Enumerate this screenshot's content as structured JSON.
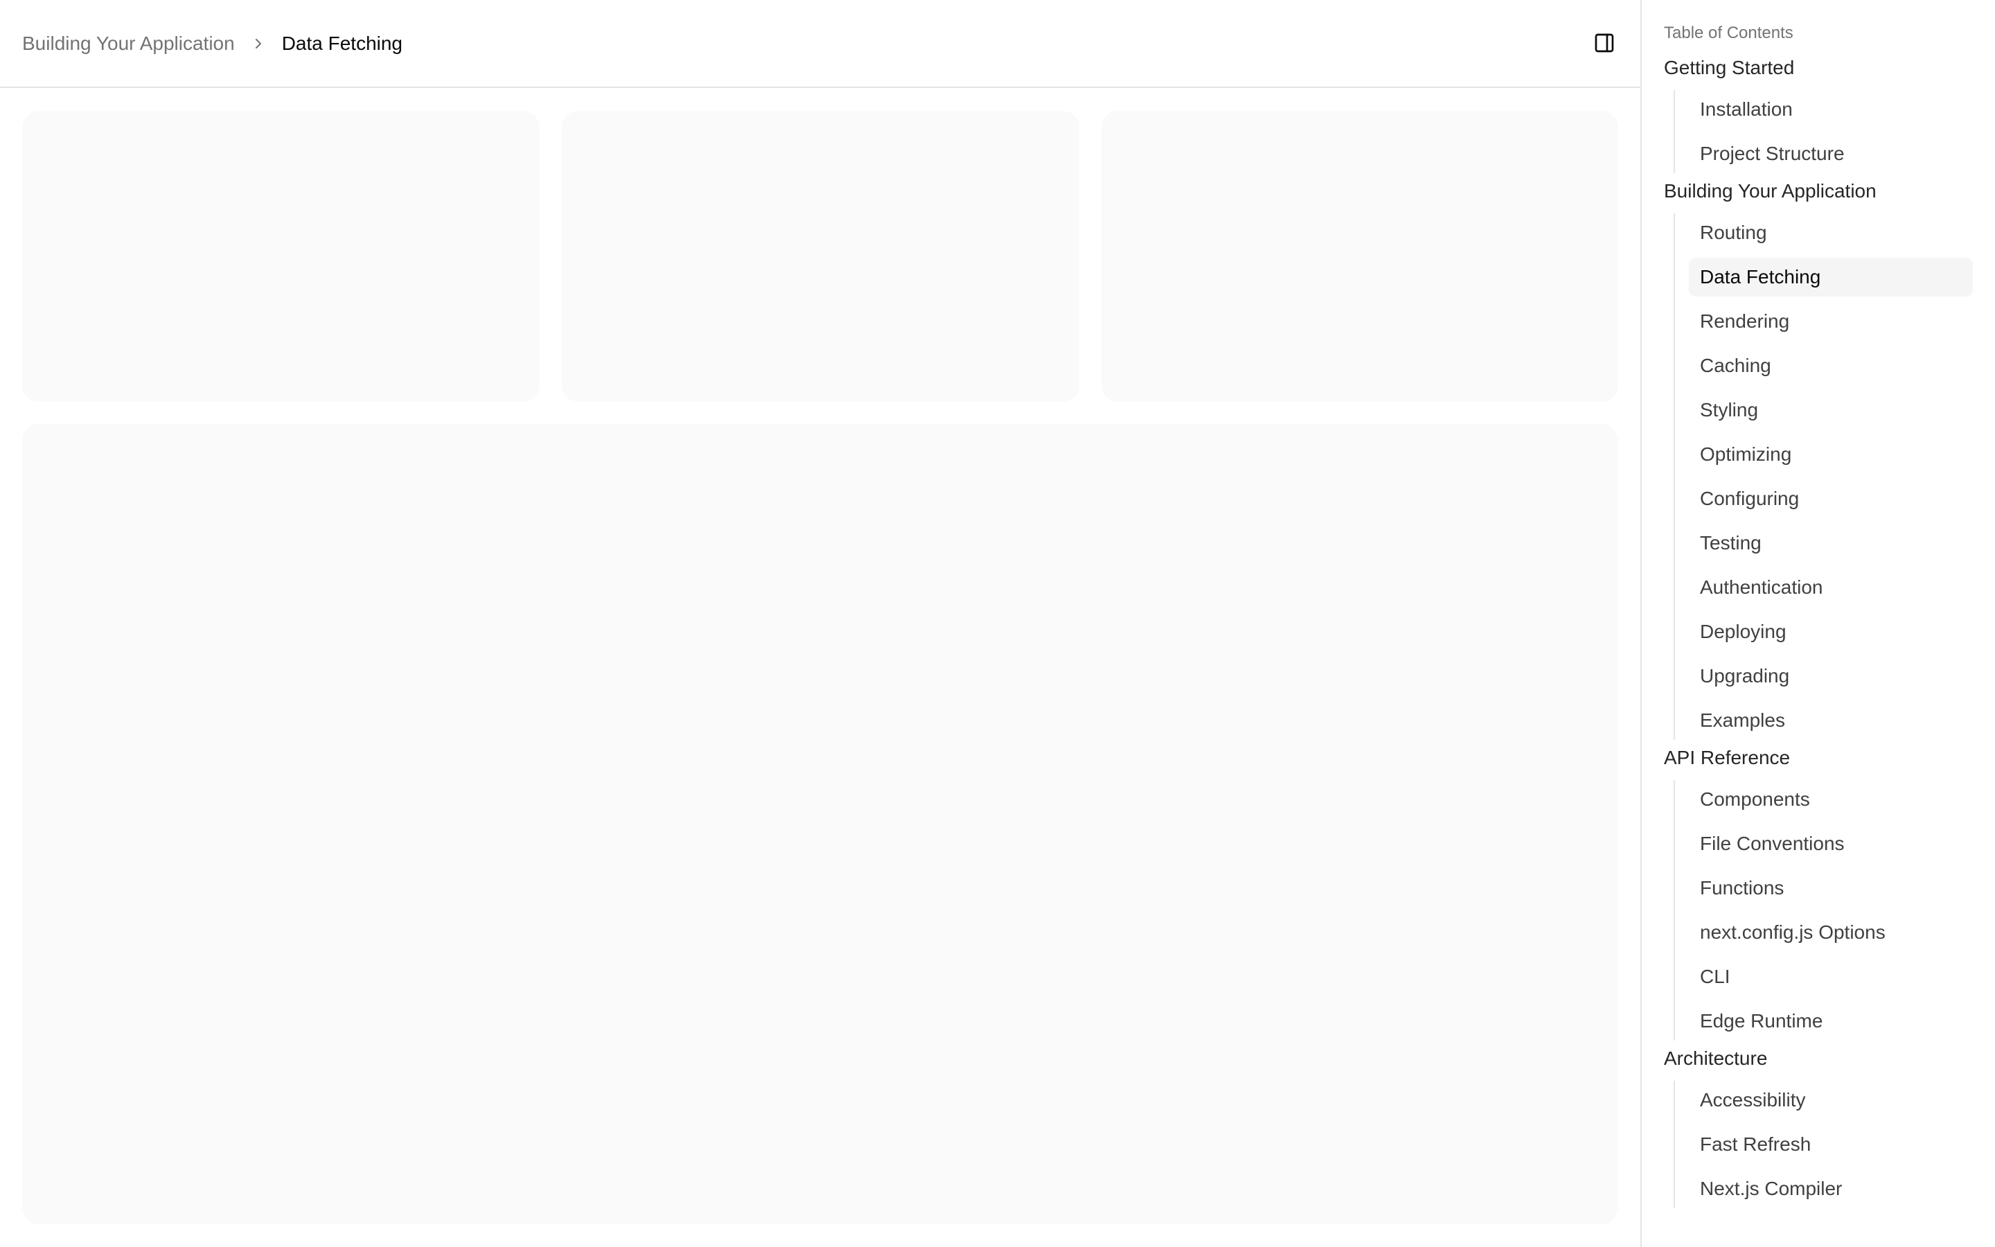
{
  "breadcrumb": {
    "parent": "Building Your Application",
    "current": "Data Fetching"
  },
  "header": {
    "panel_toggle_icon": "sidebar-panel-icon"
  },
  "sidebar": {
    "title": "Table of Contents",
    "active_item": "Data Fetching",
    "sections": [
      {
        "title": "Getting Started",
        "items": [
          "Installation",
          "Project Structure"
        ]
      },
      {
        "title": "Building Your Application",
        "items": [
          "Routing",
          "Data Fetching",
          "Rendering",
          "Caching",
          "Styling",
          "Optimizing",
          "Configuring",
          "Testing",
          "Authentication",
          "Deploying",
          "Upgrading",
          "Examples"
        ]
      },
      {
        "title": "API Reference",
        "items": [
          "Components",
          "File Conventions",
          "Functions",
          "next.config.js Options",
          "CLI",
          "Edge Runtime"
        ]
      },
      {
        "title": "Architecture",
        "items": [
          "Accessibility",
          "Fast Refresh",
          "Next.js Compiler"
        ]
      }
    ]
  },
  "colors": {
    "skeleton": "#fafafa",
    "border": "#e5e5e5",
    "active_bg": "#f5f5f5",
    "muted_text": "#737373"
  }
}
